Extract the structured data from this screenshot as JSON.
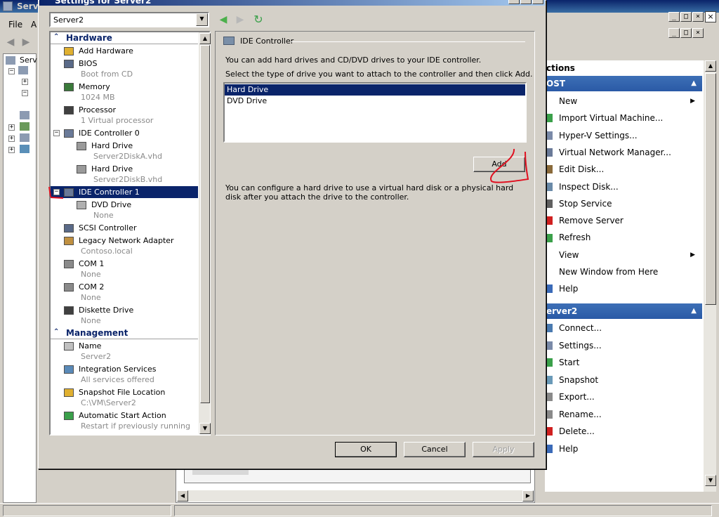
{
  "colors": {
    "accent": "#0a246a",
    "action_group": "#2a5aa6",
    "annotation_red": "#e01020"
  },
  "background": {
    "title": "Serv",
    "menu": {
      "file": "File",
      "next": "A"
    },
    "tree_root": "Serv",
    "window_controls": [
      "_",
      "□",
      "×"
    ],
    "inner_controls": [
      "_",
      "□",
      "×"
    ]
  },
  "actions": {
    "header": "ctions",
    "host_group": "OST",
    "host_items": [
      {
        "label": "New",
        "icon": "new-icon",
        "submenu": true
      },
      {
        "label": "Import Virtual Machine...",
        "icon": "import-icon",
        "submenu": false
      },
      {
        "label": "Hyper-V Settings...",
        "icon": "settings-icon",
        "submenu": false
      },
      {
        "label": "Virtual Network Manager...",
        "icon": "network-manager-icon",
        "submenu": false
      },
      {
        "label": "Edit Disk...",
        "icon": "edit-disk-icon",
        "submenu": false
      },
      {
        "label": "Inspect Disk...",
        "icon": "inspect-disk-icon",
        "submenu": false
      },
      {
        "label": "Stop Service",
        "icon": "stop-service-icon",
        "submenu": false
      },
      {
        "label": "Remove Server",
        "icon": "remove-server-icon",
        "submenu": false
      },
      {
        "label": "Refresh",
        "icon": "refresh-icon",
        "submenu": false
      },
      {
        "label": "View",
        "icon": "view-icon",
        "submenu": true
      },
      {
        "label": "New Window from Here",
        "icon": "new-window-icon",
        "submenu": false
      },
      {
        "label": "Help",
        "icon": "help-icon",
        "submenu": false
      }
    ],
    "vm_group": "erver2",
    "vm_items": [
      {
        "label": "Connect...",
        "icon": "connect-icon"
      },
      {
        "label": "Settings...",
        "icon": "settings-icon"
      },
      {
        "label": "Start",
        "icon": "start-icon"
      },
      {
        "label": "Snapshot",
        "icon": "snapshot-icon"
      },
      {
        "label": "Export...",
        "icon": "export-icon"
      },
      {
        "label": "Rename...",
        "icon": "rename-icon"
      },
      {
        "label": "Delete...",
        "icon": "delete-icon"
      },
      {
        "label": "Help",
        "icon": "help-icon"
      }
    ]
  },
  "dialog": {
    "title": "Settings for Server2",
    "vm_selector": "Server2",
    "tree": {
      "hardware_header": "Hardware",
      "management_header": "Management",
      "items": [
        {
          "label": "Add Hardware",
          "sub": "",
          "icon": "add-hardware-icon"
        },
        {
          "label": "BIOS",
          "sub": "Boot from CD",
          "icon": "bios-icon"
        },
        {
          "label": "Memory",
          "sub": "1024 MB",
          "icon": "memory-icon"
        },
        {
          "label": "Processor",
          "sub": "1 Virtual processor",
          "icon": "processor-icon"
        },
        {
          "label": "IDE Controller 0",
          "sub": "",
          "icon": "ide-controller-icon"
        },
        {
          "label": "Hard Drive",
          "sub": "Server2DiskA.vhd",
          "icon": "hard-drive-icon"
        },
        {
          "label": "Hard Drive",
          "sub": "Server2DiskB.vhd",
          "icon": "hard-drive-icon"
        },
        {
          "label": "IDE Controller 1",
          "sub": "",
          "icon": "ide-controller-icon"
        },
        {
          "label": "DVD Drive",
          "sub": "None",
          "icon": "dvd-drive-icon"
        },
        {
          "label": "SCSI Controller",
          "sub": "",
          "icon": "scsi-controller-icon"
        },
        {
          "label": "Legacy Network Adapter",
          "sub": "Contoso.local",
          "icon": "network-adapter-icon"
        },
        {
          "label": "COM 1",
          "sub": "None",
          "icon": "com-port-icon"
        },
        {
          "label": "COM 2",
          "sub": "None",
          "icon": "com-port-icon"
        },
        {
          "label": "Diskette Drive",
          "sub": "None",
          "icon": "diskette-icon"
        },
        {
          "label": "Name",
          "sub": "Server2",
          "icon": "name-icon"
        },
        {
          "label": "Integration Services",
          "sub": "All services offered",
          "icon": "integration-services-icon"
        },
        {
          "label": "Snapshot File Location",
          "sub": "C:\\VM\\Server2",
          "icon": "snapshot-folder-icon"
        },
        {
          "label": "Automatic Start Action",
          "sub": "Restart if previously running",
          "icon": "auto-start-icon"
        }
      ]
    },
    "content": {
      "title": "IDE Controller",
      "intro": "You can add hard drives and CD/DVD drives to your IDE controller.",
      "instruction": "Select the type of drive you want to attach to the controller and then click Add.",
      "drive_types": [
        "Hard Drive",
        "DVD Drive"
      ],
      "selected_drive": "Hard Drive",
      "add_button": "Add",
      "footnote": "You can configure a hard drive to use a virtual hard disk or a physical hard disk after you attach the drive to the controller."
    },
    "buttons": {
      "ok": "OK",
      "cancel": "Cancel",
      "apply": "Apply"
    }
  }
}
